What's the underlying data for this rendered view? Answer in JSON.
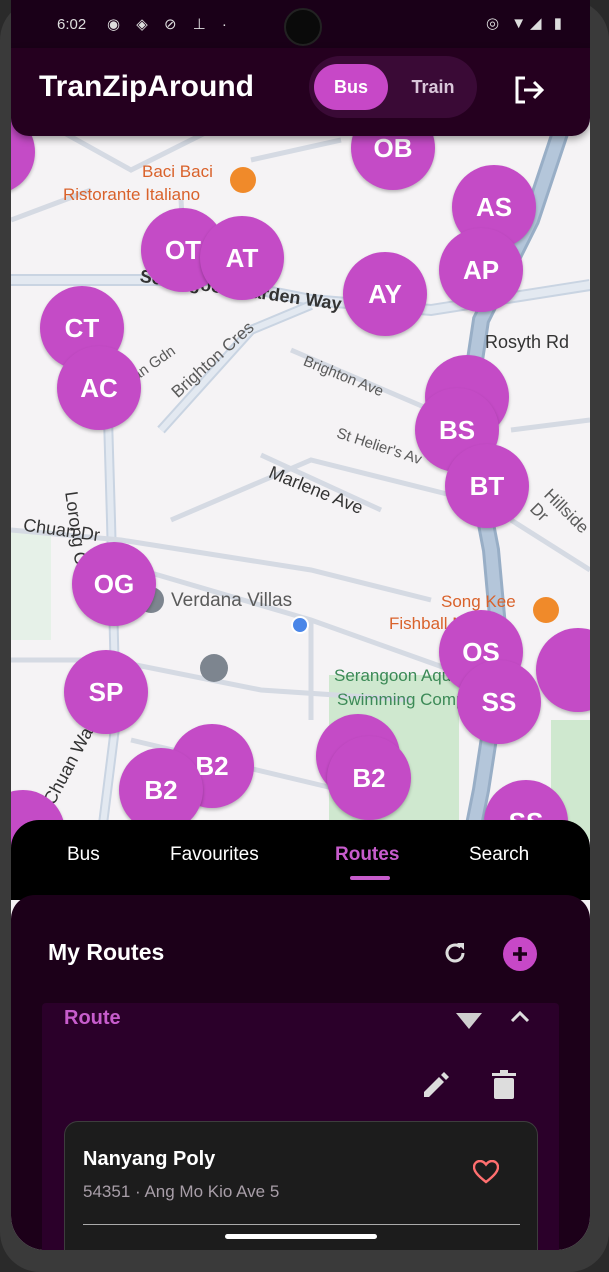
{
  "status": {
    "time": "6:02",
    "icons": "◉ ◈ ⊘ ⊥ ·"
  },
  "app": {
    "title": "TranZipAround"
  },
  "mode_toggle": {
    "bus": "Bus",
    "train": "Train",
    "selected": "Bus"
  },
  "map": {
    "labels": {
      "baci1": "Baci Baci",
      "baci2": "Ristorante Italiano",
      "serangoon_garden_way": "Serangoon Garden Way",
      "brighton_cres": "Brighton Cres",
      "brighton_ave": "Brighton Ave",
      "st_heliers": "St Helier's Av",
      "marlene_ave": "Marlene Ave",
      "rosyth_rd": "Rosyth Rd",
      "hillside_dr": "Hillside Dr",
      "chuan_dr": "Chuan Dr",
      "lorong_chuan": "Lorong Chuan",
      "verdana_villas": "Verdana Villas",
      "song_kee": "Song Kee",
      "fishball": "Fishball Noodle",
      "serangoon_swim1": "Serangoon Aquatic",
      "serangoon_swim2": "Swimming Complex",
      "chuan_walk": "Chuan Walk",
      "gdn": "an Gdn"
    },
    "markers": [
      "OB",
      "AS",
      "OT",
      "AT",
      "AY",
      "AP",
      "CT",
      "AC",
      "BS",
      "BT",
      "OG",
      "OS",
      "SS",
      "SP",
      "B2",
      "B2",
      "B2",
      "SS"
    ]
  },
  "tabs": {
    "items": [
      "Bus",
      "Favourites",
      "Routes",
      "Search"
    ],
    "active": "Routes"
  },
  "panel": {
    "heading": "My Routes",
    "route": {
      "label": "Route",
      "stop": {
        "name": "Nanyang Poly",
        "subtitle": "54351 · Ang Mo Kio Ave 5"
      }
    }
  },
  "colors": {
    "accent": "#c748c7",
    "marker": "#c44bc6",
    "appbar": "#25001f",
    "panel": "#1c0019"
  }
}
